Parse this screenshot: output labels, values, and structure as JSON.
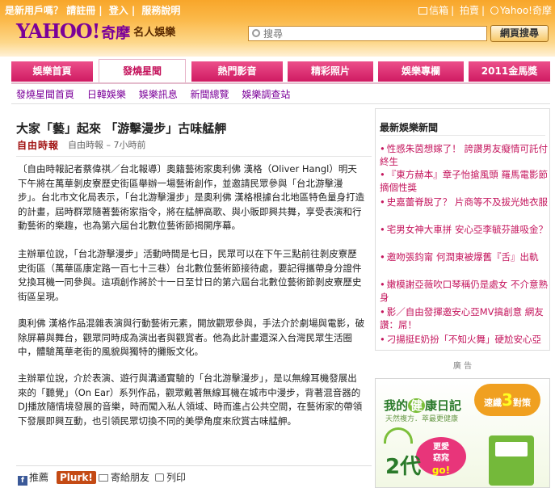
{
  "topbar": {
    "new_user": "是新用戶嗎？",
    "register": "請註冊",
    "login": "登入",
    "help": "服務說明",
    "mail": "信箱",
    "auction": "拍賣",
    "home": "Yahoo!奇摩"
  },
  "logo": {
    "yahoo": "YAHOO!",
    "qimo": "奇摩",
    "section": "名人娛樂"
  },
  "search": {
    "placeholder": "搜尋",
    "button": "網頁搜尋"
  },
  "nav": {
    "tabs": [
      {
        "label": "娛樂首頁"
      },
      {
        "label": "發燒星聞"
      },
      {
        "label": "熱門影音"
      },
      {
        "label": "精彩照片"
      },
      {
        "label": "娛樂專欄"
      },
      {
        "label": "2011金馬獎"
      }
    ],
    "active_index": 1
  },
  "subnav": [
    "發燒星聞首頁",
    "日韓娛樂",
    "娛樂訊息",
    "新聞總覽",
    "娛樂調查站"
  ],
  "article": {
    "title": "大家「藝」起來 「游擊漫步」古味艋舺",
    "source_logo": "自由時報",
    "source_meta": "自由時報 – 7小時前",
    "paragraphs": [
      "〔自由時報記者蔡偉祺／台北報導〕奧籍藝術家奧利佛 漢格（Oliver Hangl）明天下午將在萬華剝皮寮歷史街區舉辦一場藝術創作，並邀請民眾參與「台北游擊漫步」。台北市文化局表示，「台北游擊漫步」是奧利佛 漢格根據台北地區特色量身打造的計畫，屆時群眾隨著藝術家指令，將在艋舺高歌、與小販即興共舞，享受表演和行動藝術的樂趣，也為第六屆台北數位藝術節揭開序幕。",
      "主辦單位說，「台北游擊漫步」活動時間是七日，民眾可以在下午三點前往剝皮寮歷史街區（萬華區康定路一百七十三巷）台北數位藝術節接待處，要記得攜帶身分證件兌換耳機一同參與。這項創作將於十一日至廿日的第六屆台北數位藝術節剝皮寮歷史街區呈現。",
      "奧利佛 漢格作品混雜表演與行動藝術元素，開放觀眾參與，手法介於劇場與電影，破除屏幕與舞台，觀眾同時成為演出者與觀賞者。他為此計畫還深入台灣民眾生活圈中，體驗萬華老街的風貌與獨特的攤販文化。",
      "主辦單位說，介於表演、遊行與溝通實驗的「台北游擊漫步」，是以無線耳機發展出來的「聽覺」（On Ear）系列作品，觀眾戴著無線耳機在城市中漫步，背著混音器的DJ播放隨情境發展的音樂，時而闖入私人領域、時而進占公共空間，在藝術家的帶領下發展即興互動，也引領民眾切換不同的美學角度來欣賞古味艋舺。"
    ]
  },
  "share": {
    "facebook": "推薦",
    "plurk": "Plurk!",
    "email": "寄給朋友",
    "print": "列印"
  },
  "sidebar": {
    "title": "最新娛樂新聞",
    "items": [
      "性感朱茵想嫁了！ 誇讚男友癡情可託付終生",
      "『東方赫本』章子怡搶風頭 羅馬電影節摘個性獎",
      "史嘉蕾脊脫了？ 片商等不及拔光她衣服",
      "宅男女神大車拼 安心亞李毓芬誰吸金？",
      "邀吻張鈞甯 何潤東被爆舊『舌』出軌",
      "嫩模謝亞薇吹口琴稱仍是處女 不介意熟身",
      "影／自由發揮邀安心亞MV搞創意 網友讚：屌！",
      "刁揚挺E奶扮「不知火舞」硬尬安心亞"
    ]
  },
  "ad": {
    "label": "廣 告",
    "brand_prefix": "我的",
    "brand_highlight": "健",
    "brand_suffix": "康日記",
    "tagline": "天然複方．萃最更健康",
    "badge_prefix": "速纖",
    "badge_num": "3",
    "badge_suffix": "對策",
    "promo_line1": "更愛",
    "promo_line2": "窈窕",
    "promo_go": "go!",
    "big_number": "2代"
  },
  "colors": {
    "header_orange": "#f8a62a",
    "nav_pink": "#d41e66",
    "link_purple": "#7b0099",
    "news_pink": "#c4145c"
  }
}
